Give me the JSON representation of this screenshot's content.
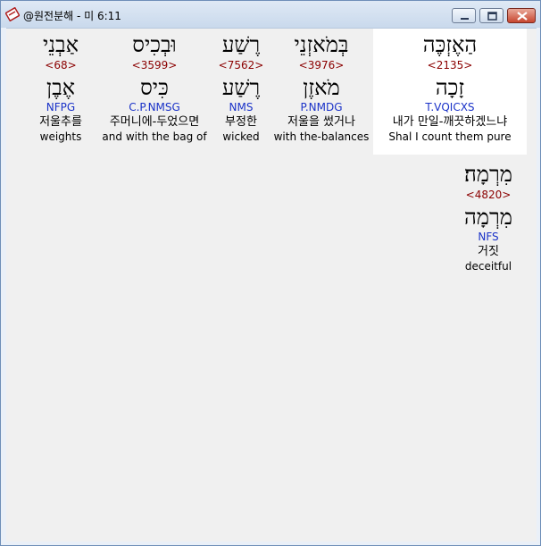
{
  "window": {
    "title": "@원전분해 - 미 6:11",
    "controls": {
      "minimize": "minimize",
      "maximize": "maximize",
      "close": "close"
    }
  },
  "words": [
    {
      "hebrew": "הַאֶזְכֶּה",
      "strong": "<2135>",
      "lemma": "זָכָה",
      "parse": "T.VQICXS",
      "korean": "내가 만일-깨끗하겠느냐",
      "english": "Shal I count them pure",
      "selected": true
    },
    {
      "hebrew": "בְּמֹאזְנֵי",
      "strong": "<3976>",
      "lemma": "מֹאזֶן",
      "parse": "P.NMDG",
      "korean": "저울을 썼거나",
      "english": "with the-balances",
      "selected": false
    },
    {
      "hebrew": "רֶשַׁע",
      "strong": "<7562>",
      "lemma": "רֶשַׁע",
      "parse": "NMS",
      "korean": "부정한",
      "english": "wicked",
      "selected": false
    },
    {
      "hebrew": "וּבְכִיס",
      "strong": "<3599>",
      "lemma": "כִּיס",
      "parse": "C.P.NMSG",
      "korean": "주머니에-두었으면",
      "english": "and with the bag of",
      "selected": false
    },
    {
      "hebrew": "אַבְנֵי",
      "strong": "<68>",
      "lemma": "אֶבֶן",
      "parse": "NFPG",
      "korean": "저울추를",
      "english": "weights",
      "selected": false
    },
    {
      "hebrew": "מִרְמָה׃",
      "strong": "<4820>",
      "lemma": "מִרְמָה",
      "parse": "NFS",
      "korean": "거짓",
      "english": "deceitful",
      "selected": false
    }
  ]
}
